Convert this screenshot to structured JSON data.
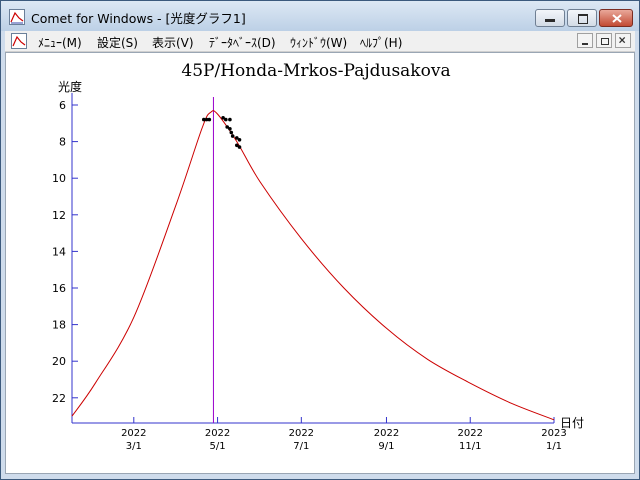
{
  "window": {
    "title": "Comet for Windows - [光度グラフ1]",
    "icon": "graph-app-icon"
  },
  "menubar": {
    "items": [
      {
        "label": "ﾒﾆｭｰ(M)"
      },
      {
        "label": "設定(S)"
      },
      {
        "label": "表示(V)"
      },
      {
        "label": "ﾃﾞｰﾀﾍﾞｰｽ(D)"
      },
      {
        "label": "ｳｨﾝﾄﾞｳ(W)"
      },
      {
        "label": "ﾍﾙﾌﾟ(H)"
      }
    ]
  },
  "chart_data": {
    "type": "line",
    "title": "45P/Honda-Mrkos-Pajdusakova",
    "ylabel": "光度",
    "xlabel": "日付",
    "y_inverted": true,
    "ylim": [
      5.5,
      23.2
    ],
    "yticks": [
      6,
      8,
      10,
      12,
      14,
      16,
      18,
      20,
      22
    ],
    "xticks": [
      {
        "year": "2022",
        "date": "3/1"
      },
      {
        "year": "2022",
        "date": "5/1"
      },
      {
        "year": "2022",
        "date": "7/1"
      },
      {
        "year": "2022",
        "date": "9/1"
      },
      {
        "year": "2022",
        "date": "11/1"
      },
      {
        "year": "2023",
        "date": "1/1"
      }
    ],
    "series": [
      {
        "kind": "curve",
        "color": "#cc0000",
        "points": [
          [
            "2022-01-15",
            23.0
          ],
          [
            "2022-02-01",
            21.2
          ],
          [
            "2022-03-01",
            17.6
          ],
          [
            "2022-04-01",
            11.4
          ],
          [
            "2022-04-20",
            7.2
          ],
          [
            "2022-04-26",
            6.4
          ],
          [
            "2022-05-01",
            6.5
          ],
          [
            "2022-05-15",
            8.0
          ],
          [
            "2022-06-01",
            10.2
          ],
          [
            "2022-07-01",
            13.3
          ],
          [
            "2022-08-01",
            16.0
          ],
          [
            "2022-09-01",
            18.2
          ],
          [
            "2022-10-01",
            19.9
          ],
          [
            "2022-11-01",
            21.2
          ],
          [
            "2022-12-01",
            22.3
          ],
          [
            "2023-01-01",
            23.2
          ]
        ]
      },
      {
        "kind": "observations",
        "color": "#000000",
        "points": [
          [
            "2022-04-21",
            6.8
          ],
          [
            "2022-04-23",
            6.8
          ],
          [
            "2022-04-25",
            6.8
          ],
          [
            "2022-05-05",
            6.7
          ],
          [
            "2022-05-07",
            6.8
          ],
          [
            "2022-05-08",
            7.2
          ],
          [
            "2022-05-10",
            6.8
          ],
          [
            "2022-05-10",
            7.3
          ],
          [
            "2022-05-11",
            7.5
          ],
          [
            "2022-05-12",
            7.7
          ],
          [
            "2022-05-15",
            7.8
          ],
          [
            "2022-05-15",
            8.2
          ],
          [
            "2022-05-17",
            7.9
          ],
          [
            "2022-05-17",
            8.3
          ]
        ]
      }
    ],
    "marker_line": {
      "date": "2022-04-28",
      "color": "#9900cc"
    },
    "axis_color": "#3333cc"
  }
}
